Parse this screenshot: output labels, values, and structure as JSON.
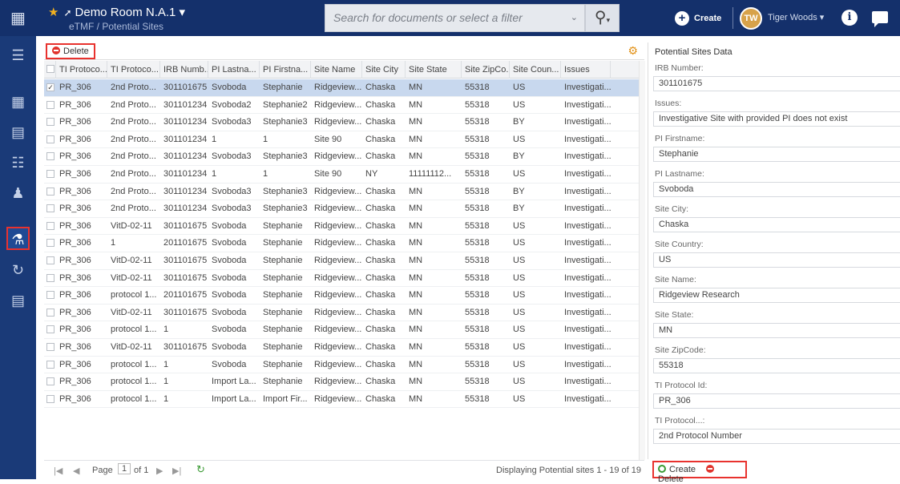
{
  "header": {
    "room_title": "Demo Room N.A.1",
    "breadcrumb": "eTMF / Potential Sites",
    "search_placeholder": "Search for documents or select a filter",
    "create_label": "Create",
    "user_initials": "TW",
    "user_name": "Tiger Woods"
  },
  "toolbar": {
    "delete_label": "Delete"
  },
  "columns": [
    "TI Protoco...",
    "TI Protoco...",
    "IRB Numb...",
    "PI Lastna...",
    "PI Firstna...",
    "Site Name",
    "Site City",
    "Site State",
    "Site ZipCo...",
    "Site Coun...",
    "Issues"
  ],
  "rows": [
    [
      "PR_306",
      "2nd Proto...",
      "301101675",
      "Svoboda",
      "Stephanie",
      "Ridgeview...",
      "Chaska",
      "MN",
      "55318",
      "US",
      "Investigati..."
    ],
    [
      "PR_306",
      "2nd Proto...",
      "301101234",
      "Svoboda2",
      "Stephanie2",
      "Ridgeview...",
      "Chaska",
      "MN",
      "55318",
      "US",
      "Investigati..."
    ],
    [
      "PR_306",
      "2nd Proto...",
      "301101234",
      "Svoboda3",
      "Stephanie3",
      "Ridgeview...",
      "Chaska",
      "MN",
      "55318",
      "BY",
      "Investigati..."
    ],
    [
      "PR_306",
      "2nd Proto...",
      "301101234",
      "1",
      "1",
      "Site 90",
      "Chaska",
      "MN",
      "55318",
      "US",
      "Investigati..."
    ],
    [
      "PR_306",
      "2nd Proto...",
      "301101234",
      "Svoboda3",
      "Stephanie3",
      "Ridgeview...",
      "Chaska",
      "MN",
      "55318",
      "BY",
      "Investigati..."
    ],
    [
      "PR_306",
      "2nd Proto...",
      "301101234",
      "1",
      "1",
      "Site 90",
      "NY",
      "11111112...",
      "55318",
      "US",
      "Investigati..."
    ],
    [
      "PR_306",
      "2nd Proto...",
      "301101234",
      "Svoboda3",
      "Stephanie3",
      "Ridgeview...",
      "Chaska",
      "MN",
      "55318",
      "BY",
      "Investigati..."
    ],
    [
      "PR_306",
      "2nd Proto...",
      "301101234",
      "Svoboda3",
      "Stephanie3",
      "Ridgeview...",
      "Chaska",
      "MN",
      "55318",
      "BY",
      "Investigati..."
    ],
    [
      "PR_306",
      "VitD-02-11",
      "301101675",
      "Svoboda",
      "Stephanie",
      "Ridgeview...",
      "Chaska",
      "MN",
      "55318",
      "US",
      "Investigati..."
    ],
    [
      "PR_306",
      "1",
      "201101675",
      "Svoboda",
      "Stephanie",
      "Ridgeview...",
      "Chaska",
      "MN",
      "55318",
      "US",
      "Investigati..."
    ],
    [
      "PR_306",
      "VitD-02-11",
      "301101675",
      "Svoboda",
      "Stephanie",
      "Ridgeview...",
      "Chaska",
      "MN",
      "55318",
      "US",
      "Investigati..."
    ],
    [
      "PR_306",
      "VitD-02-11",
      "301101675",
      "Svoboda",
      "Stephanie",
      "Ridgeview...",
      "Chaska",
      "MN",
      "55318",
      "US",
      "Investigati..."
    ],
    [
      "PR_306",
      "protocol 1...",
      "201101675",
      "Svoboda",
      "Stephanie",
      "Ridgeview...",
      "Chaska",
      "MN",
      "55318",
      "US",
      "Investigati..."
    ],
    [
      "PR_306",
      "VitD-02-11",
      "301101675",
      "Svoboda",
      "Stephanie",
      "Ridgeview...",
      "Chaska",
      "MN",
      "55318",
      "US",
      "Investigati..."
    ],
    [
      "PR_306",
      "protocol 1...",
      "1",
      "Svoboda",
      "Stephanie",
      "Ridgeview...",
      "Chaska",
      "MN",
      "55318",
      "US",
      "Investigati..."
    ],
    [
      "PR_306",
      "VitD-02-11",
      "301101675",
      "Svoboda",
      "Stephanie",
      "Ridgeview...",
      "Chaska",
      "MN",
      "55318",
      "US",
      "Investigati..."
    ],
    [
      "PR_306",
      "protocol 1...",
      "1",
      "Svoboda",
      "Stephanie",
      "Ridgeview...",
      "Chaska",
      "MN",
      "55318",
      "US",
      "Investigati..."
    ],
    [
      "PR_306",
      "protocol 1...",
      "1",
      "Import La...",
      "Stephanie",
      "Ridgeview...",
      "Chaska",
      "MN",
      "55318",
      "US",
      "Investigati..."
    ],
    [
      "PR_306",
      "protocol 1...",
      "1",
      "Import La...",
      "Import Fir...",
      "Ridgeview...",
      "Chaska",
      "MN",
      "55318",
      "US",
      "Investigati..."
    ]
  ],
  "pager": {
    "page_label": "Page",
    "page_value": "1",
    "of_label": "of 1",
    "display_text": "Displaying Potential sites 1 - 19 of 19"
  },
  "panel": {
    "title": "Potential Sites Data",
    "fields": [
      {
        "label": "IRB Number:",
        "value": "301101675"
      },
      {
        "label": "Issues:",
        "value": "Investigative Site with provided PI does not exist"
      },
      {
        "label": "PI Firstname:",
        "value": "Stephanie"
      },
      {
        "label": "PI Lastname:",
        "value": "Svoboda"
      },
      {
        "label": "Site City:",
        "value": "Chaska"
      },
      {
        "label": "Site Country:",
        "value": "US"
      },
      {
        "label": "Site Name:",
        "value": "Ridgeview Research"
      },
      {
        "label": "Site State:",
        "value": "MN"
      },
      {
        "label": "Site ZipCode:",
        "value": "55318"
      },
      {
        "label": "TI Protocol Id:",
        "value": "PR_306"
      },
      {
        "label": "TI Protocol...:",
        "value": "2nd Protocol Number"
      }
    ],
    "create_label": "Create",
    "delete_label": "Delete"
  }
}
